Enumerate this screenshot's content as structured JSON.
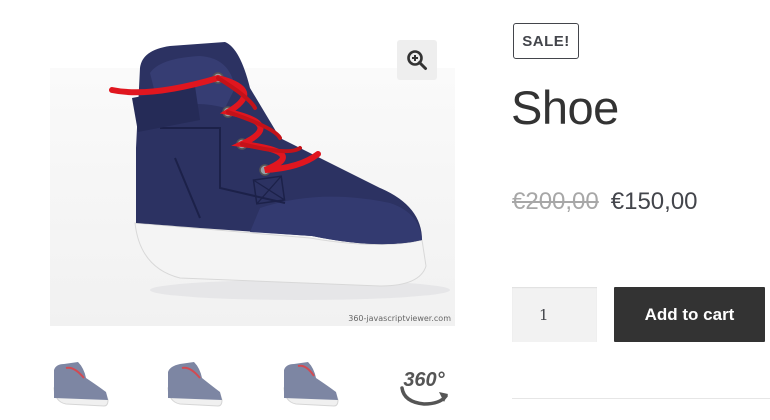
{
  "gallery": {
    "main_image_alt": "Navy blue high-top sneaker with red laces",
    "watermark": "360-javascriptviewer.com",
    "zoom_icon": "magnify-plus-icon",
    "thumbnails": [
      {
        "icon": "shoe-thumbnail"
      },
      {
        "icon": "shoe-thumbnail"
      },
      {
        "icon": "shoe-thumbnail"
      },
      {
        "icon": "360-view-icon",
        "label": "360°"
      }
    ]
  },
  "product": {
    "badge": "SALE!",
    "title": "Shoe",
    "old_price": "€200,00",
    "new_price": "€150,00"
  },
  "cart": {
    "quantity": "1",
    "add_to_cart_label": "Add to cart"
  },
  "colors": {
    "button_bg": "#333333",
    "text": "#43454b",
    "old_price": "#a7a7a7",
    "shoe_navy": "#2c3262",
    "laces_red": "#e0161f"
  }
}
